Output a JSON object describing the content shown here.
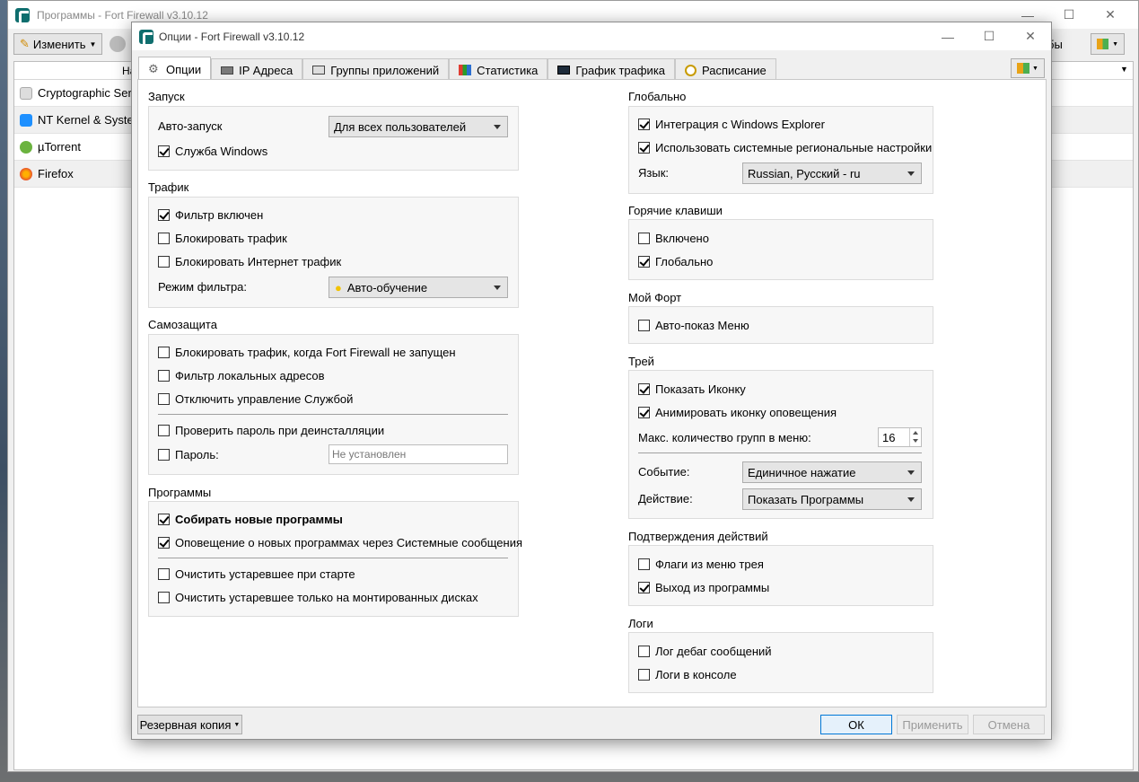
{
  "background_window": {
    "title": "Программы - Fort Firewall v3.10.12",
    "edit_button": "Изменить",
    "right_fragment": "бы",
    "column_header_fragment": "На",
    "rows": [
      {
        "name": "Cryptographic Servi",
        "icon": "app-icon-generic"
      },
      {
        "name": "NT Kernel & Syster",
        "icon": "windows-icon"
      },
      {
        "name": "µTorrent",
        "icon": "utorrent-icon"
      },
      {
        "name": "Firefox",
        "icon": "firefox-icon"
      }
    ]
  },
  "dialog": {
    "title": "Опции - Fort Firewall v3.10.12",
    "tabs": [
      {
        "label": "Опции",
        "icon": "gear-icon",
        "active": true
      },
      {
        "label": "IP Адреса",
        "icon": "network-card-icon",
        "active": false
      },
      {
        "label": "Группы приложений",
        "icon": "app-groups-icon",
        "active": false
      },
      {
        "label": "Статистика",
        "icon": "bar-chart-icon",
        "active": false
      },
      {
        "label": "График трафика",
        "icon": "traffic-graph-icon",
        "active": false
      },
      {
        "label": "Расписание",
        "icon": "clock-icon",
        "active": false
      }
    ],
    "left": {
      "startup": {
        "title": "Запуск",
        "autostart_label": "Авто-запуск",
        "autostart_value": "Для всех пользователей",
        "windows_service": "Служба Windows"
      },
      "traffic": {
        "title": "Трафик",
        "filter_enabled": "Фильтр включен",
        "block_traffic": "Блокировать трафик",
        "block_internet": "Блокировать Интернет трафик",
        "filter_mode_label": "Режим фильтра:",
        "filter_mode_value": "Авто-обучение"
      },
      "protection": {
        "title": "Самозащита",
        "block_when_not_running": "Блокировать трафик, когда Fort Firewall не запущен",
        "filter_local": "Фильтр локальных адресов",
        "disable_service_control": "Отключить управление Службой",
        "check_password_uninstall": "Проверить пароль при деинсталляции",
        "password_label": "Пароль:",
        "password_placeholder": "Не установлен"
      },
      "programs": {
        "title": "Программы",
        "collect_new": "Собирать новые программы",
        "notify_new": "Оповещение о новых программах через Системные сообщения",
        "purge_on_start": "Очистить устаревшее при старте",
        "purge_mounted": "Очистить устаревшее только на монтированных дисках"
      }
    },
    "right": {
      "global": {
        "title": "Глобально",
        "explorer_integration": "Интеграция с Windows Explorer",
        "use_system_locale": "Использовать системные региональные настройки",
        "language_label": "Язык:",
        "language_value": "Russian, Русский - ru"
      },
      "hotkeys": {
        "title": "Горячие клавиши",
        "enabled": "Включено",
        "global": "Глобально"
      },
      "my_fort": {
        "title": "Мой Форт",
        "auto_show_menu": "Авто-показ Меню"
      },
      "tray": {
        "title": "Трей",
        "show_icon": "Показать Иконку",
        "animate_icon": "Анимировать иконку оповещения",
        "max_groups_label": "Макс. количество групп в меню:",
        "max_groups_value": "16",
        "event_label": "Событие:",
        "event_value": "Единичное нажатие",
        "action_label": "Действие:",
        "action_value": "Показать Программы"
      },
      "confirmations": {
        "title": "Подтверждения действий",
        "tray_flags": "Флаги из меню трея",
        "exit_program": "Выход из программы"
      },
      "logs": {
        "title": "Логи",
        "debug_log": "Лог дебаг сообщений",
        "console_log": "Логи в консоле"
      }
    },
    "footer": {
      "backup": "Резервная копия",
      "ok": "ОК",
      "apply": "Применить",
      "cancel": "Отмена"
    }
  },
  "colors": {
    "accent": "#0078d7",
    "logo": "#0f6e6e"
  }
}
